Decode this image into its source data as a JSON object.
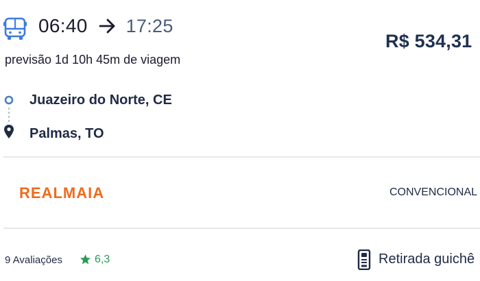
{
  "trip": {
    "departure_time": "06:40",
    "arrival_time": "17:25",
    "duration_text": "previsão 1d 10h 45m de viagem",
    "price": "R$ 534,31"
  },
  "route": {
    "origin": "Juazeiro do Norte, CE",
    "destination": "Palmas, TO"
  },
  "operator": {
    "name": "REALMAIA",
    "bus_class": "CONVENCIONAL"
  },
  "footer": {
    "reviews_label": "9 Avaliações",
    "rating": "6,3",
    "pickup_label": "Retirada guichê"
  },
  "icons": {
    "bus": "bus-icon",
    "arrow": "arrow-right-icon",
    "origin": "origin-dot-icon",
    "destination": "location-pin-icon",
    "star": "star-icon",
    "ticket": "ticket-kiosk-icon"
  },
  "colors": {
    "bus_icon": "#3d7be0",
    "origin_dot": "#4a7fc1",
    "operator_brand": "#f26a1b",
    "rating": "#2a9a56",
    "price": "#1f3152"
  }
}
